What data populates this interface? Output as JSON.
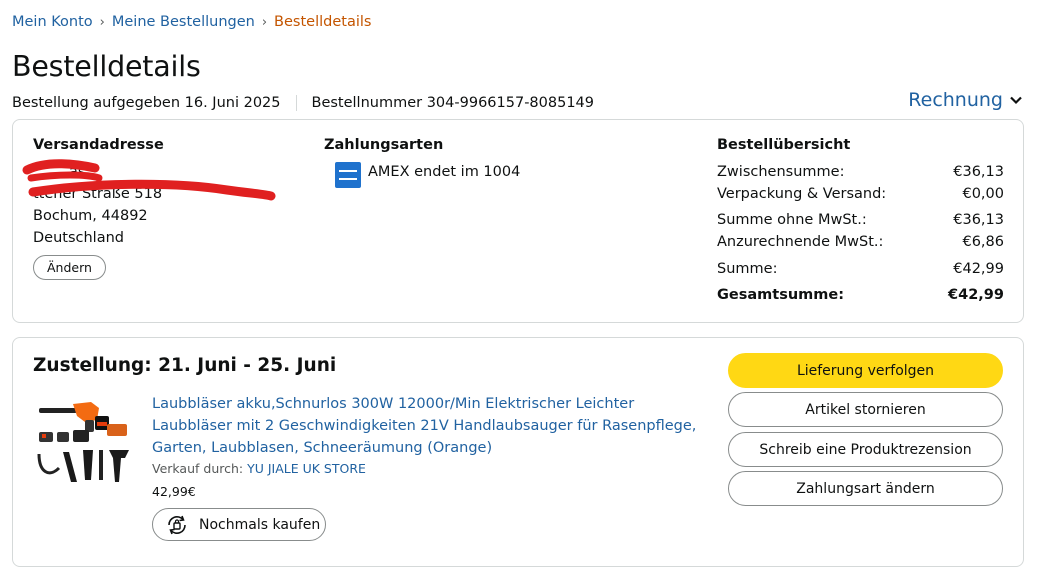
{
  "breadcrumb": {
    "items": [
      "Mein Konto",
      "Meine Bestellungen"
    ],
    "current": "Bestelldetails",
    "separator": "›"
  },
  "page": {
    "title": "Bestelldetails",
    "order_date": "Bestellung aufgegeben 16. Juni 2025",
    "order_number": "Bestellnummer 304-9966157-8085149",
    "invoice_label": "Rechnung"
  },
  "shipping": {
    "title": "Versandadresse",
    "lines": [
      "as",
      "ttener Straße 518",
      "Bochum, 44892",
      "Deutschland"
    ],
    "change_label": "Ändern"
  },
  "payment": {
    "title": "Zahlungsarten",
    "method": "AMEX endet im 1004",
    "icon": "amex-card-icon"
  },
  "summary": {
    "title": "Bestellübersicht",
    "rows": [
      {
        "label": "Zwischensumme:",
        "value": "€36,13"
      },
      {
        "label": "Verpackung & Versand:",
        "value": "€0,00"
      },
      {
        "label": "Summe ohne MwSt.:",
        "value": "€36,13"
      },
      {
        "label": "Anzurechnende MwSt.:",
        "value": "€6,86"
      },
      {
        "label": "Summe:",
        "value": "€42,99"
      },
      {
        "label": "Gesamtsumme:",
        "value": "€42,99"
      }
    ]
  },
  "delivery": {
    "title": "Zustellung: 21. Juni - 25. Juni",
    "product_title": "Laubbläser akku,Schnurlos 300W 12000r/Min Elektrischer Leichter Laubbläser mit 2 Geschwindigkeiten 21V Handlaubsauger für Rasenpflege, Garten, Laubblasen, Schneeräumung (Orange)",
    "seller_prefix": "Verkauf durch: ",
    "seller_name": "YU JIALE UK STORE",
    "price": "42,99€",
    "buy_again_label": "Nochmals kaufen"
  },
  "actions": [
    "Lieferung verfolgen",
    "Artikel stornieren",
    "Schreib eine Produktrezension",
    "Zahlungsart ändern"
  ],
  "colors": {
    "link": "#2162a1",
    "current_crumb": "#c45500",
    "primary_button": "#ffd814",
    "amex": "#1f72cd",
    "redaction": "#e02020"
  }
}
